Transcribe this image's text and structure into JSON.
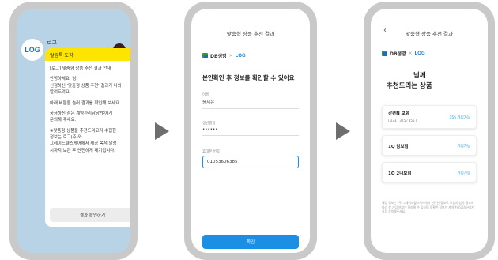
{
  "screen1": {
    "avatar_text": "LOG",
    "sender": "로그",
    "badge": "kakao",
    "bubble_header": "알림톡 도착",
    "lines": [
      "[로그] 맞춤형 상품 추천 결과 안내",
      "안녕하세요, 님!\n신청하신 '맞춤형 상품 추천' 결과가 나와\n알려드려요.",
      "아래 버튼을 눌러 결과를 확인해 보세요.",
      "궁금하신 점은 계약관리담당FP에게\n문의해 주세요.",
      "※맞춤형 상품을 추천드리고자 수집한\n정보는 로그(주)와\n그레이드헬스케어에서 제공 목적 달성\n시까지 보관 후 안전하게 폐기됩니다."
    ],
    "button": "결과 확인하기"
  },
  "screen2": {
    "title": "맞춤형 상품 추천 결과",
    "brand_db": "DB생명",
    "brand_x": "×",
    "brand_log": "LOG",
    "heading": "본인확인 후 정보를 확인할 수 있어요",
    "name_label": "이름",
    "name_value": "윤시은",
    "birth_label": "생년월일",
    "birth_value": "••••••",
    "phone_label": "휴대폰 번호",
    "phone_value": "01053606385",
    "confirm": "확인"
  },
  "screen3": {
    "back_icon": "chevron-left",
    "title": "맞춤형 상품 추천 결과",
    "brand_db": "DB생명",
    "brand_x": "×",
    "brand_log": "LOG",
    "greet_line1": "님께",
    "greet_line2": "추천드리는 상품",
    "cards": [
      {
        "name": "간편N 보험",
        "sub": "( 233 / 325 / 355 )",
        "status": "355 가입가능"
      },
      {
        "name": "1Q 암보험",
        "status": "가입가능"
      },
      {
        "name": "1Q 2대보험",
        "status": "가입가능"
      }
    ],
    "disclaimer": "해당 정보는 (주)그레이드헬스케어에서 판단한 정보로 보험사 심사 결과에 따라 실 가입 여부는 달라질 수 있으며 정확한 정보는 계약관리담당FP에게 직접 문의해주세요."
  },
  "colors": {
    "accent": "#1a8fe3",
    "kakao_yellow": "#fee500",
    "chat_bg": "#b9d3e6"
  }
}
